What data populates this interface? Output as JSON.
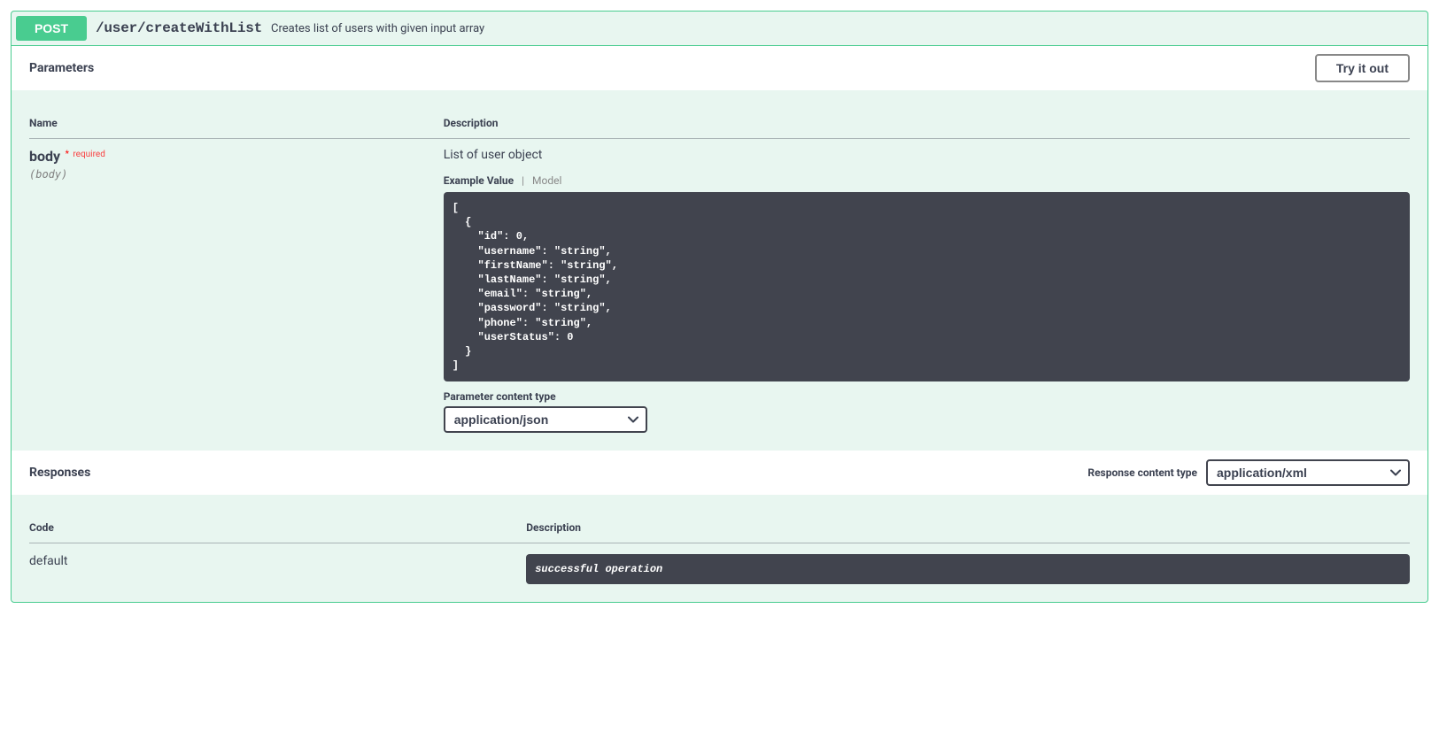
{
  "operation": {
    "method": "POST",
    "path": "/user/createWithList",
    "summary": "Creates list of users with given input array"
  },
  "parameters": {
    "section_title": "Parameters",
    "try_label": "Try it out",
    "headers": {
      "name": "Name",
      "description": "Description"
    },
    "rows": [
      {
        "name": "body",
        "required_mark": "*",
        "required_text": "required",
        "in": "(body)",
        "description": "List of user object",
        "tabs": {
          "active": "Example Value",
          "inactive": "Model"
        },
        "example": "[\n  {\n    \"id\": 0,\n    \"username\": \"string\",\n    \"firstName\": \"string\",\n    \"lastName\": \"string\",\n    \"email\": \"string\",\n    \"password\": \"string\",\n    \"phone\": \"string\",\n    \"userStatus\": 0\n  }\n]",
        "content_type_label": "Parameter content type",
        "content_type_value": "application/json"
      }
    ]
  },
  "responses": {
    "section_title": "Responses",
    "content_type_label": "Response content type",
    "content_type_value": "application/xml",
    "headers": {
      "code": "Code",
      "description": "Description"
    },
    "rows": [
      {
        "code": "default",
        "description": "successful operation"
      }
    ]
  }
}
